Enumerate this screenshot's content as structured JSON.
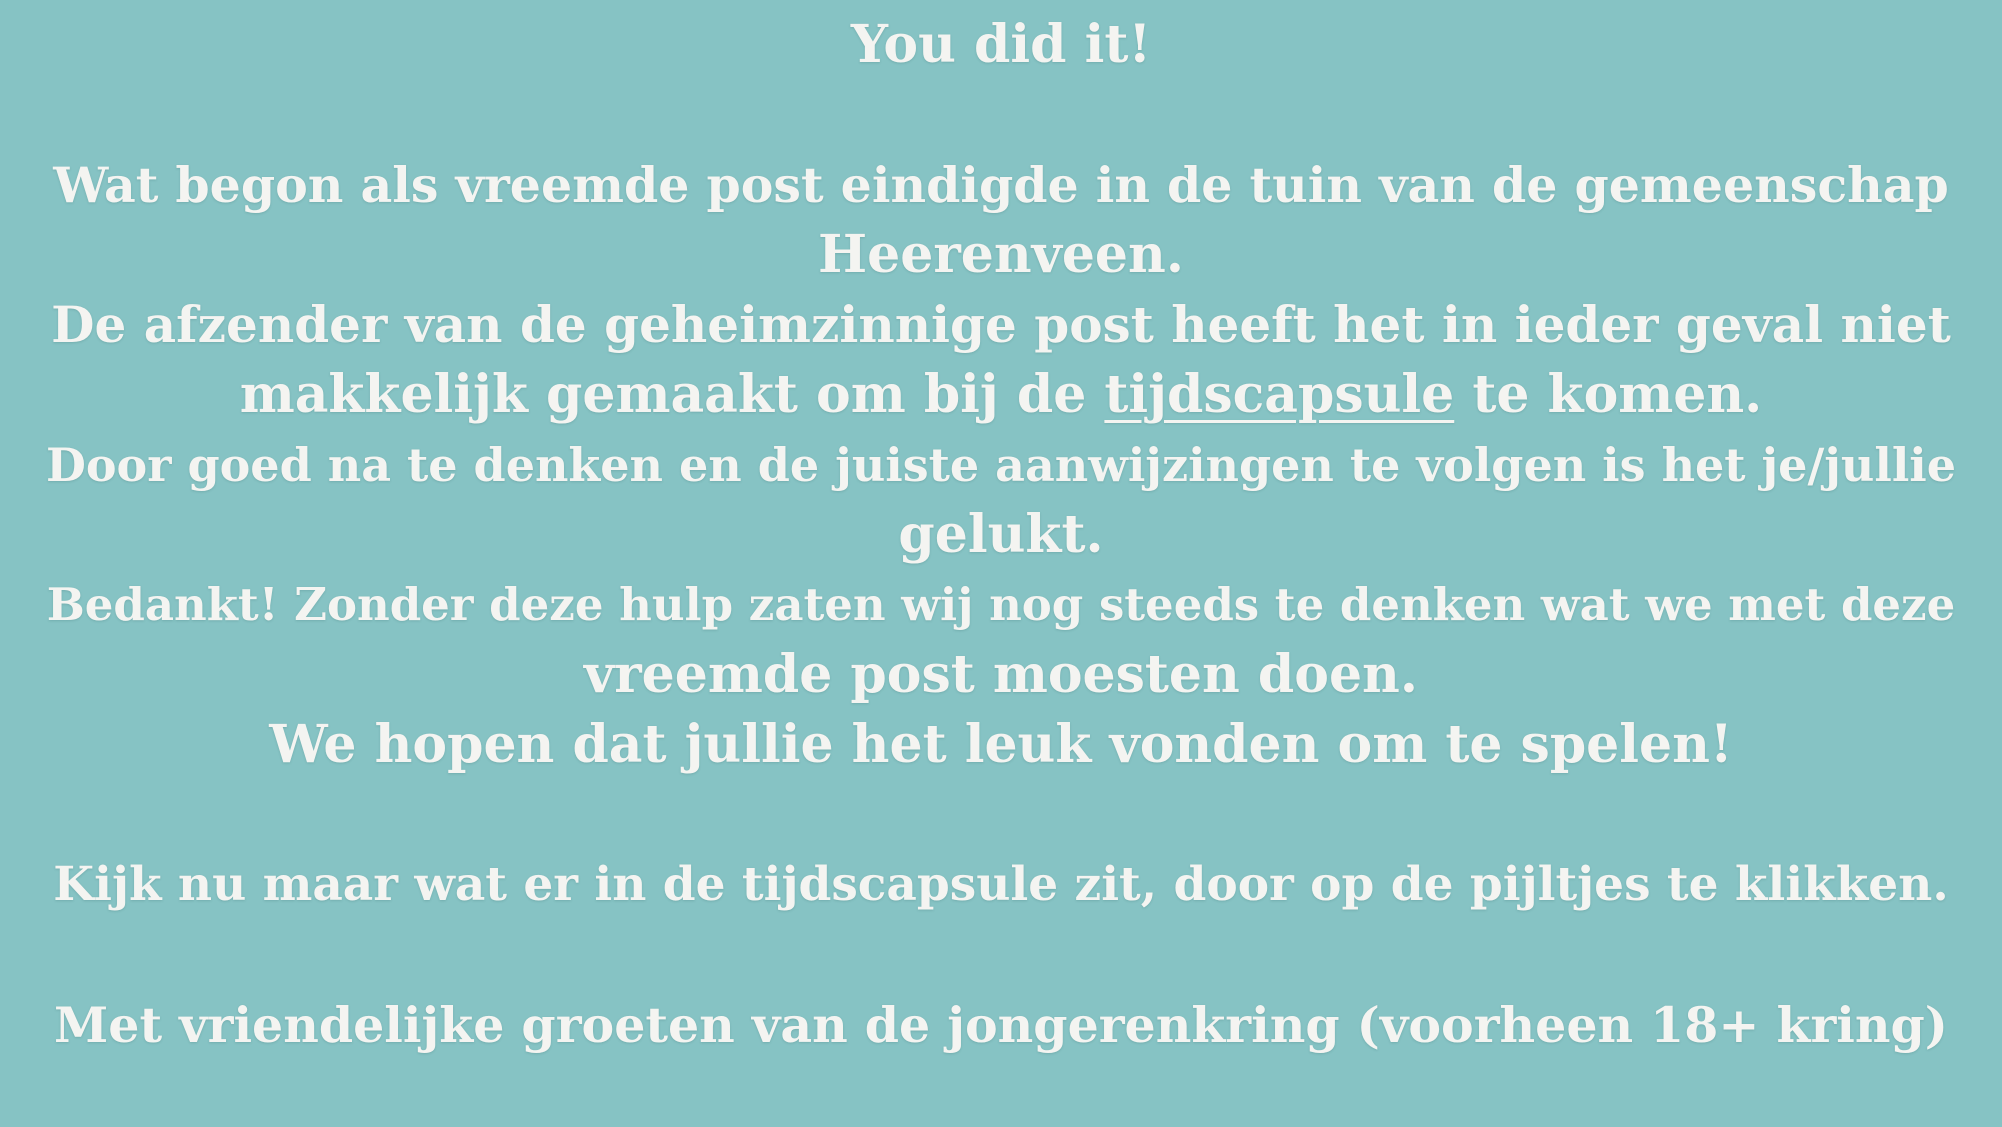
{
  "message": {
    "title": "You did it!",
    "p1_line1": "Wat begon als vreemde post eindigde in de tuin van de gemeenschap",
    "p1_line2": "Heerenveen.",
    "p2_line1": "De afzender van de geheimzinnige post heeft het in ieder geval niet",
    "p2_line2_before": "makkelijk gemaakt om bij de ",
    "p2_link": "tijdscapsule",
    "p2_line2_after": " te komen.",
    "p3_line1": "Door goed na te denken en de juiste aanwijzingen te volgen is het je/jullie",
    "p3_line2": "gelukt.",
    "p4_line1": "Bedankt! Zonder deze hulp zaten wij nog steeds te denken wat we met deze",
    "p4_line2": "vreemde post moesten doen.",
    "p5_line1": "We hopen dat jullie het leuk vonden om te spelen!",
    "instruction": "Kijk nu maar wat er in de tijdscapsule zit, door op de pijltjes te klikken.",
    "closing": "Met vriendelijke groeten van de jongerenkring (voorheen 18+ kring)"
  },
  "colors": {
    "background": "#86c3c4",
    "text": "#f4f4f1"
  }
}
